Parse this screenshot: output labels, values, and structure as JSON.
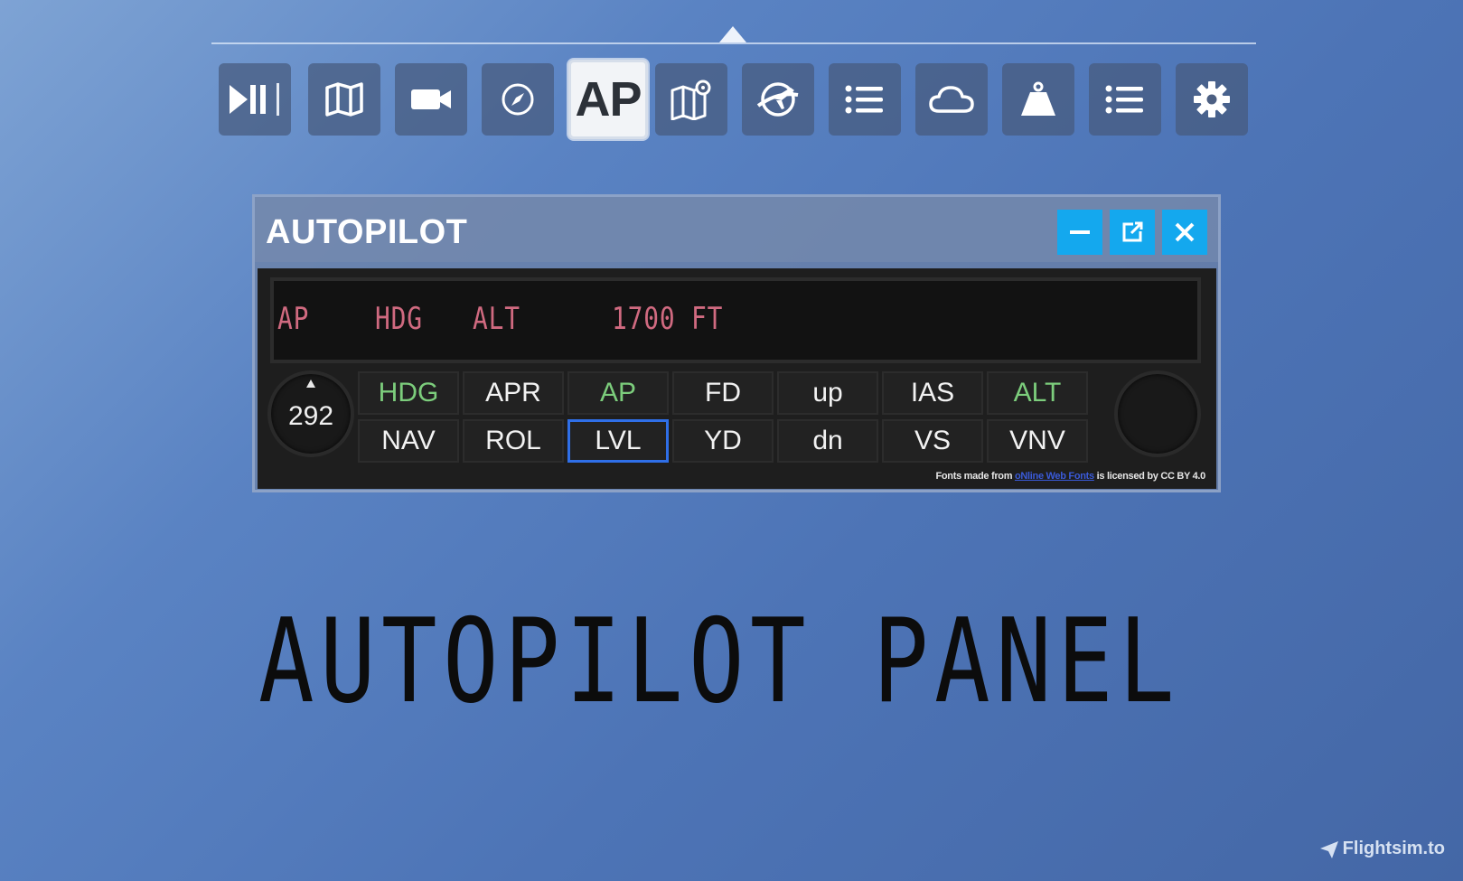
{
  "toolbar": {
    "items": [
      {
        "icon": "play-pause-icon"
      },
      {
        "icon": "map-icon"
      },
      {
        "icon": "camera-icon"
      },
      {
        "icon": "compass-icon"
      },
      {
        "icon": "ap-text",
        "label": "AP",
        "active": true
      },
      {
        "icon": "map-pin-icon"
      },
      {
        "icon": "plane-globe-icon"
      },
      {
        "icon": "list-icon"
      },
      {
        "icon": "cloud-icon"
      },
      {
        "icon": "weight-icon"
      },
      {
        "icon": "list-icon"
      },
      {
        "icon": "gear-icon"
      }
    ]
  },
  "window": {
    "title": "AUTOPILOT",
    "controls": [
      "minimize-icon",
      "external-icon",
      "close-icon"
    ]
  },
  "display": {
    "ap": "AP",
    "hdg": "HDG",
    "alt": "ALT",
    "altitude": "1700 FT"
  },
  "knob": {
    "value": "292"
  },
  "buttons": {
    "row1": [
      {
        "label": "HDG",
        "on": true
      },
      {
        "label": "APR",
        "on": false
      },
      {
        "label": "AP",
        "on": true
      },
      {
        "label": "FD",
        "on": false
      },
      {
        "label": "up",
        "on": false
      },
      {
        "label": "IAS",
        "on": false
      },
      {
        "label": "ALT",
        "on": true
      }
    ],
    "row2": [
      {
        "label": "NAV",
        "on": false
      },
      {
        "label": "ROL",
        "on": false
      },
      {
        "label": "LVL",
        "on": false,
        "selected": true
      },
      {
        "label": "YD",
        "on": false
      },
      {
        "label": "dn",
        "on": false
      },
      {
        "label": "VS",
        "on": false
      },
      {
        "label": "VNV",
        "on": false
      }
    ]
  },
  "credit": {
    "prefix": "Fonts made from",
    "link": "oNline Web Fonts",
    "suffix": "is licensed by CC BY 4.0"
  },
  "caption": "AUTOPILOT PANEL",
  "watermark": "Flightsim.to",
  "colors": {
    "display_text": "#d06a80",
    "button_on": "#7ccd7c",
    "selected_border": "#2f6fe8",
    "window_button": "#14a8ee"
  }
}
